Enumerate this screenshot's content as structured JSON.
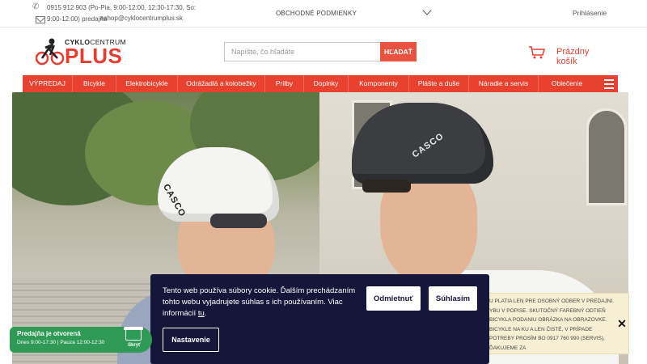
{
  "topbar": {
    "phone": "0915 912 903 (Po-Pia, 9:00-12:00, 12:30-17:30, So: 9:00-12:00) predajňa",
    "email": "eshop@cyklocentrumplus.sk",
    "terms": "OBCHODNÉ PODMIENKY",
    "login": "Prihlásenie"
  },
  "header": {
    "logo_top_a": "CYKLO",
    "logo_top_b": "CENTRUM",
    "logo_main": "PLUS",
    "search_placeholder": "Napíšte, čo hľadáte",
    "search_button": "HĽADAŤ",
    "cart_label": "Prázdny košík"
  },
  "nav": {
    "items": [
      "VÝPREDAJ",
      "Bicykle",
      "Elektrobicykle",
      "Odrážadlá a kolobežky",
      "Prilby",
      "Doplnky",
      "Komponenty",
      "Plášte a duše",
      "Náradie a servis",
      "Oblečenie"
    ]
  },
  "hero": {
    "helmet_brand_1": "CASCO",
    "helmet_brand_2": "CASCO"
  },
  "cookie": {
    "text": "Tento web používa súbory cookie. Ďalším prechádzaním tohto webu vyjadrujete súhlas s ich používaním. Viac informácií ",
    "link": "tu",
    "text_end": ".",
    "decline": "Odmietnuť",
    "accept": "Súhlasím",
    "settings": "Nastavenie"
  },
  "notice": {
    "text": "U PLATIA LEN PRE OSOBNÝ ODBER V PREDAJNI. ybu v popise. Skutočný farebný odtieň bicykla podaniu obrázka na obrazovke. BICYKLE NA KU A LEN ČISTÉ, V PRÍPADE POTREBY PROSÍM BO 0917 760 990 (SERVIS), ĎAKUJEME ZA",
    "close": "✕"
  },
  "hours": {
    "title": "Predajňa je otvorená",
    "detail": "Dnes 9:00-17:30 | Pauza 12:00-12:30",
    "hide": "Skryť"
  }
}
